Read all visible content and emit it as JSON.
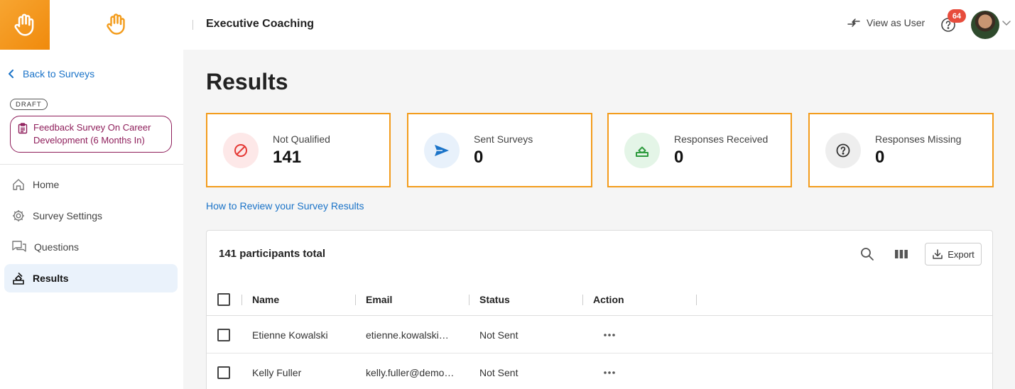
{
  "header": {
    "app_title": "Executive Coaching",
    "view_as_label": "View as User",
    "notification_count": "64"
  },
  "sidebar": {
    "back_label": "Back to Surveys",
    "status_badge": "DRAFT",
    "survey_name": "Feedback Survey On Career Development (6 Months In)",
    "items": [
      {
        "label": "Home",
        "icon": "home-icon"
      },
      {
        "label": "Survey Settings",
        "icon": "gear-icon"
      },
      {
        "label": "Questions",
        "icon": "chat-icon"
      },
      {
        "label": "Results",
        "icon": "results-icon",
        "active": true
      }
    ]
  },
  "main": {
    "title": "Results",
    "stats": [
      {
        "label": "Not Qualified",
        "value": "141",
        "icon": "ban-icon",
        "color": "#e53935",
        "bg": "#fde8e8"
      },
      {
        "label": "Sent Surveys",
        "value": "0",
        "icon": "send-icon",
        "color": "#1a73c8",
        "bg": "#e8f1fb"
      },
      {
        "label": "Responses Received",
        "value": "0",
        "icon": "ballot-icon",
        "color": "#2e9b3e",
        "bg": "#e4f5e7"
      },
      {
        "label": "Responses Missing",
        "value": "0",
        "icon": "question-icon",
        "color": "#333333",
        "bg": "#eeeeee"
      }
    ],
    "review_link": "How to Review your Survey Results",
    "table": {
      "count_label": "141 participants total",
      "export_label": "Export",
      "columns": [
        "Name",
        "Email",
        "Status",
        "Action"
      ],
      "rows": [
        {
          "name": "Etienne Kowalski",
          "email": "etienne.kowalski…",
          "status": "Not Sent"
        },
        {
          "name": "Kelly Fuller",
          "email": "kelly.fuller@demo…",
          "status": "Not Sent"
        }
      ]
    }
  },
  "colors": {
    "accent": "#f39c1c",
    "link": "#1a73c8",
    "survey_chip": "#8e1d5a"
  }
}
